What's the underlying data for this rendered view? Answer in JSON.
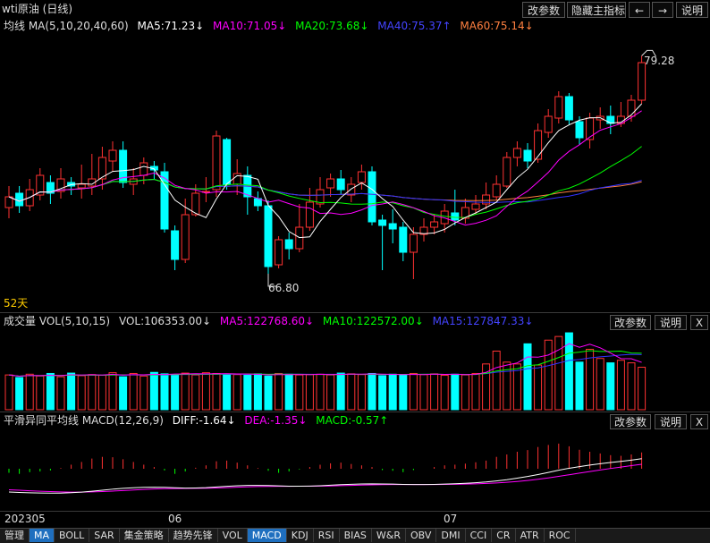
{
  "title": "wti原油 (日线)",
  "top_buttons": {
    "params": "改参数",
    "hide_indicator": "隐藏主指标",
    "prev": "←",
    "next": "→",
    "help": "说明"
  },
  "ma_header": {
    "name": "均线 MA(5,10,20,40,60)",
    "ma5": "MA5:71.23↓",
    "ma10": "MA10:71.05↓",
    "ma20": "MA20:73.68↓",
    "ma40": "MA40:75.37↑",
    "ma60": "MA60:75.14↓"
  },
  "price_labels": {
    "high": "79.28",
    "low": "66.80",
    "days": "52天"
  },
  "vol_header": {
    "name": "成交量 VOL(5,10,15)",
    "vol": "VOL:106353.00↓",
    "ma5": "MA5:122768.60↓",
    "ma10": "MA10:122572.00↓",
    "ma15": "MA15:127847.33↓"
  },
  "macd_header": {
    "name": "平滑异同平均线 MACD(12,26,9)",
    "diff": "DIFF:-1.64↓",
    "dea": "DEA:-1.35↓",
    "macd": "MACD:-0.57↑"
  },
  "panel_buttons": {
    "params": "改参数",
    "help": "说明",
    "close": "X"
  },
  "dates": {
    "d1": "202305",
    "d2": "06",
    "d3": "07"
  },
  "tabs": [
    "管理",
    "MA",
    "BOLL",
    "SAR",
    "集金策略",
    "趋势先锋",
    "VOL",
    "MACD",
    "KDJ",
    "RSI",
    "BIAS",
    "W&R",
    "OBV",
    "DMI",
    "CCI",
    "CR",
    "ATR",
    "ROC"
  ],
  "active_tabs": [
    "MA",
    "MACD"
  ],
  "colors": {
    "up": "#ff3232",
    "down": "#00ffff",
    "ma5": "#ffffff",
    "ma10": "#ff00ff",
    "ma20": "#00ff00",
    "ma40": "#3232ff",
    "ma60": "#ff8040"
  },
  "chart_data": {
    "type": "candlestick",
    "ylim": [
      66,
      80
    ],
    "candles": [
      {
        "o": 70.8,
        "c": 71.4,
        "h": 72.0,
        "l": 70.2
      },
      {
        "o": 71.6,
        "c": 70.9,
        "h": 72.0,
        "l": 70.5
      },
      {
        "o": 70.9,
        "c": 71.8,
        "h": 72.4,
        "l": 70.6
      },
      {
        "o": 71.5,
        "c": 72.6,
        "h": 73.0,
        "l": 71.2
      },
      {
        "o": 72.2,
        "c": 71.6,
        "h": 72.6,
        "l": 71.0
      },
      {
        "o": 71.7,
        "c": 72.4,
        "h": 73.0,
        "l": 71.3
      },
      {
        "o": 72.2,
        "c": 72.0,
        "h": 72.5,
        "l": 71.5
      },
      {
        "o": 71.9,
        "c": 72.1,
        "h": 73.2,
        "l": 71.3
      },
      {
        "o": 72.0,
        "c": 72.4,
        "h": 73.8,
        "l": 71.5
      },
      {
        "o": 72.4,
        "c": 73.6,
        "h": 74.2,
        "l": 71.8
      },
      {
        "o": 73.4,
        "c": 74.0,
        "h": 74.5,
        "l": 72.8
      },
      {
        "o": 74.0,
        "c": 72.2,
        "h": 74.5,
        "l": 71.9
      },
      {
        "o": 72.1,
        "c": 72.4,
        "h": 73.0,
        "l": 71.5
      },
      {
        "o": 72.6,
        "c": 73.3,
        "h": 73.6,
        "l": 72.1
      },
      {
        "o": 73.1,
        "c": 72.9,
        "h": 73.4,
        "l": 72.4
      },
      {
        "o": 72.8,
        "c": 69.6,
        "h": 73.3,
        "l": 69.4
      },
      {
        "o": 69.5,
        "c": 67.9,
        "h": 69.8,
        "l": 67.3
      },
      {
        "o": 67.9,
        "c": 70.4,
        "h": 71.3,
        "l": 67.7
      },
      {
        "o": 70.4,
        "c": 71.6,
        "h": 72.1,
        "l": 70.3
      },
      {
        "o": 71.7,
        "c": 71.7,
        "h": 72.5,
        "l": 71.1
      },
      {
        "o": 71.8,
        "c": 74.8,
        "h": 75.1,
        "l": 71.4
      },
      {
        "o": 74.6,
        "c": 72.1,
        "h": 74.7,
        "l": 71.8
      },
      {
        "o": 72.1,
        "c": 72.7,
        "h": 73.5,
        "l": 71.5
      },
      {
        "o": 72.6,
        "c": 71.4,
        "h": 73.1,
        "l": 70.4
      },
      {
        "o": 71.3,
        "c": 70.9,
        "h": 71.7,
        "l": 70.6
      },
      {
        "o": 70.9,
        "c": 67.5,
        "h": 71.2,
        "l": 67.1
      },
      {
        "o": 67.6,
        "c": 69.0,
        "h": 69.2,
        "l": 67.4
      },
      {
        "o": 69.0,
        "c": 68.5,
        "h": 69.4,
        "l": 67.9
      },
      {
        "o": 68.5,
        "c": 69.7,
        "h": 71.0,
        "l": 68.3
      },
      {
        "o": 69.7,
        "c": 71.1,
        "h": 71.9,
        "l": 69.5
      },
      {
        "o": 71.0,
        "c": 71.8,
        "h": 72.5,
        "l": 70.8
      },
      {
        "o": 71.9,
        "c": 72.4,
        "h": 72.7,
        "l": 71.4
      },
      {
        "o": 72.4,
        "c": 71.8,
        "h": 72.9,
        "l": 71.5
      },
      {
        "o": 71.5,
        "c": 72.1,
        "h": 72.5,
        "l": 71.1
      },
      {
        "o": 72.2,
        "c": 72.8,
        "h": 73.2,
        "l": 71.8
      },
      {
        "o": 72.8,
        "c": 70.0,
        "h": 73.1,
        "l": 69.8
      },
      {
        "o": 70.1,
        "c": 69.8,
        "h": 70.4,
        "l": 67.3
      },
      {
        "o": 69.9,
        "c": 69.6,
        "h": 70.7,
        "l": 68.8
      },
      {
        "o": 69.7,
        "c": 68.3,
        "h": 70.0,
        "l": 67.8
      },
      {
        "o": 68.3,
        "c": 69.3,
        "h": 69.7,
        "l": 66.8
      },
      {
        "o": 69.3,
        "c": 69.7,
        "h": 70.2,
        "l": 68.9
      },
      {
        "o": 69.7,
        "c": 70.0,
        "h": 70.4,
        "l": 69.3
      },
      {
        "o": 69.9,
        "c": 70.6,
        "h": 71.0,
        "l": 69.4
      },
      {
        "o": 70.5,
        "c": 70.1,
        "h": 71.8,
        "l": 69.8
      },
      {
        "o": 70.2,
        "c": 70.8,
        "h": 71.3,
        "l": 69.9
      },
      {
        "o": 70.7,
        "c": 71.0,
        "h": 71.5,
        "l": 70.4
      },
      {
        "o": 71.0,
        "c": 71.5,
        "h": 72.2,
        "l": 70.7
      },
      {
        "o": 71.4,
        "c": 72.1,
        "h": 72.6,
        "l": 71.2
      },
      {
        "o": 72.0,
        "c": 73.6,
        "h": 73.9,
        "l": 71.9
      },
      {
        "o": 73.6,
        "c": 74.1,
        "h": 74.5,
        "l": 73.1
      },
      {
        "o": 74.0,
        "c": 73.4,
        "h": 74.4,
        "l": 73.0
      },
      {
        "o": 73.5,
        "c": 75.1,
        "h": 75.5,
        "l": 73.3
      },
      {
        "o": 75.0,
        "c": 75.9,
        "h": 76.3,
        "l": 74.7
      },
      {
        "o": 75.8,
        "c": 77.0,
        "h": 77.3,
        "l": 75.5
      },
      {
        "o": 77.0,
        "c": 75.7,
        "h": 77.2,
        "l": 75.4
      },
      {
        "o": 75.6,
        "c": 74.7,
        "h": 75.9,
        "l": 74.3
      },
      {
        "o": 74.6,
        "c": 75.8,
        "h": 76.1,
        "l": 74.1
      },
      {
        "o": 75.7,
        "c": 75.9,
        "h": 76.4,
        "l": 75.2
      },
      {
        "o": 75.9,
        "c": 75.5,
        "h": 76.5,
        "l": 74.9
      },
      {
        "o": 75.5,
        "c": 75.9,
        "h": 76.7,
        "l": 75.3
      },
      {
        "o": 75.9,
        "c": 76.8,
        "h": 77.1,
        "l": 75.6
      },
      {
        "o": 76.8,
        "c": 78.9,
        "h": 79.28,
        "l": 76.6
      }
    ],
    "volume": [
      95,
      88,
      97,
      92,
      99,
      90,
      100,
      93,
      96,
      94,
      101,
      90,
      99,
      92,
      102,
      98,
      96,
      100,
      95,
      101,
      99,
      97,
      96,
      94,
      98,
      92,
      99,
      97,
      95,
      96,
      97,
      95,
      100,
      98,
      96,
      99,
      93,
      97,
      95,
      99,
      96,
      98,
      94,
      97,
      95,
      99,
      125,
      160,
      130,
      125,
      180,
      122,
      190,
      200,
      210,
      130,
      165,
      140,
      128,
      135,
      128,
      116
    ],
    "macd_hist": [
      -0.12,
      -0.15,
      -0.1,
      -0.08,
      -0.05,
      0.02,
      0.12,
      0.2,
      0.3,
      0.35,
      0.34,
      0.28,
      0.2,
      0.12,
      0.05,
      -0.05,
      -0.15,
      -0.08,
      0.03,
      0.1,
      0.22,
      0.24,
      0.18,
      0.1,
      0.02,
      -0.06,
      -0.12,
      -0.08,
      -0.02,
      0.05,
      0.12,
      0.16,
      0.18,
      0.14,
      0.1,
      0.05,
      -0.04,
      -0.06,
      -0.1,
      -0.04,
      0.0,
      0.05,
      0.1,
      0.12,
      0.15,
      0.19,
      0.24,
      0.35,
      0.42,
      0.5,
      0.55,
      0.64,
      0.7,
      0.74,
      0.66,
      0.56,
      0.5,
      0.45,
      0.4,
      0.38,
      0.42,
      0.48
    ]
  }
}
